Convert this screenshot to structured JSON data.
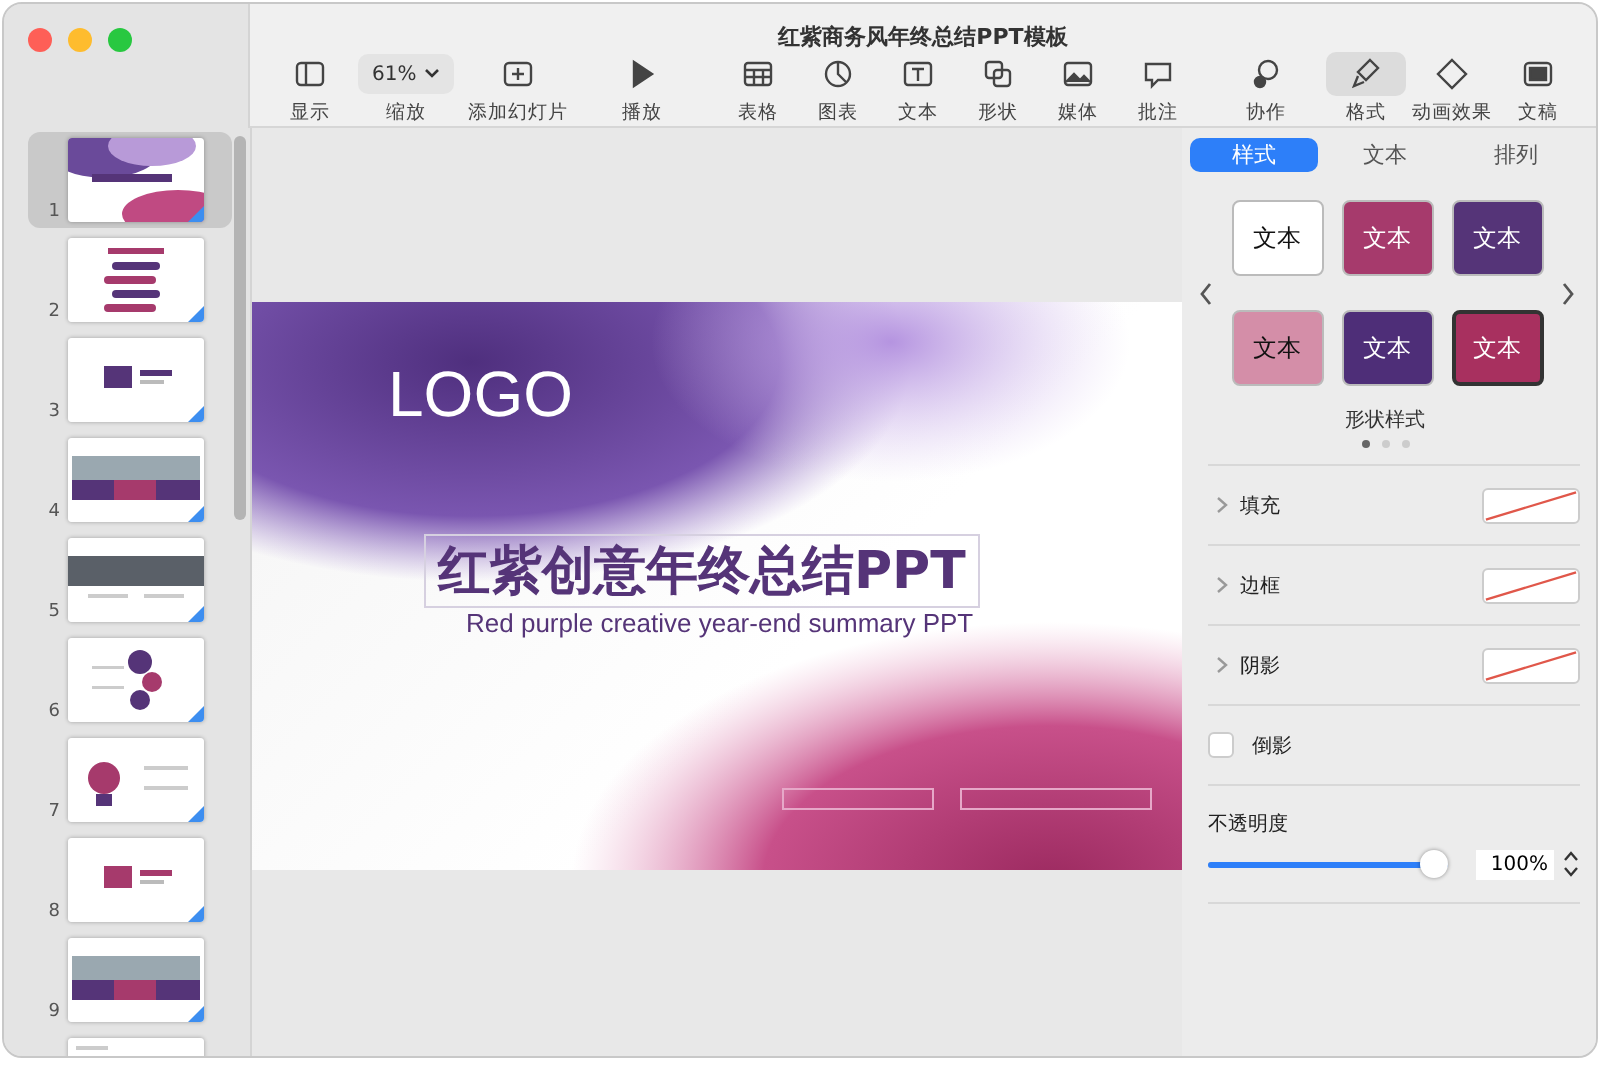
{
  "window": {
    "title": "红紫商务风年终总结PPT模板"
  },
  "toolbar": [
    {
      "kind": "sidebar",
      "label": "显示",
      "selected": false
    },
    {
      "kind": "zoom",
      "label": "缩放",
      "value": "61%",
      "selected": false
    },
    {
      "kind": "add",
      "label": "添加幻灯片",
      "selected": false
    },
    {
      "kind": "play",
      "label": "播放",
      "selected": false
    },
    {
      "kind": "table",
      "label": "表格",
      "selected": false
    },
    {
      "kind": "chart",
      "label": "图表",
      "selected": false
    },
    {
      "kind": "text",
      "label": "文本",
      "selected": false
    },
    {
      "kind": "shape",
      "label": "形状",
      "selected": false
    },
    {
      "kind": "media",
      "label": "媒体",
      "selected": false
    },
    {
      "kind": "comment",
      "label": "批注",
      "selected": false
    },
    {
      "kind": "collaborate",
      "label": "协作",
      "selected": false
    },
    {
      "kind": "format",
      "label": "格式",
      "selected": true
    },
    {
      "kind": "animate",
      "label": "动画效果",
      "selected": false
    },
    {
      "kind": "document",
      "label": "文稿",
      "selected": false
    }
  ],
  "slides": [
    {
      "number": "1",
      "kind": "cover",
      "selected": true
    },
    {
      "number": "2",
      "kind": "agenda",
      "selected": false
    },
    {
      "number": "3",
      "kind": "section",
      "selected": false
    },
    {
      "number": "4",
      "kind": "photo-grid",
      "selected": false
    },
    {
      "number": "5",
      "kind": "photo-strip",
      "selected": false
    },
    {
      "number": "6",
      "kind": "diagram",
      "selected": false
    },
    {
      "number": "7",
      "kind": "infographic",
      "selected": false
    },
    {
      "number": "8",
      "kind": "section",
      "selected": false
    },
    {
      "number": "9",
      "kind": "photo-grid",
      "selected": false
    },
    {
      "kind": "plain",
      "selected": false
    }
  ],
  "slide": {
    "logo": "LOGO",
    "title": "红紫创意年终总结PPT",
    "subtitle": "Red purple creative year-end summary PPT"
  },
  "inspector": {
    "tabs": [
      {
        "label": "样式",
        "selected": true
      },
      {
        "label": "文本",
        "selected": false
      },
      {
        "label": "排列",
        "selected": false
      }
    ],
    "swatches": [
      {
        "label": "文本",
        "color": "#ffffff",
        "selected": false
      },
      {
        "label": "文本",
        "color": "#a63a6c",
        "selected": false
      },
      {
        "label": "文本",
        "color": "#553478",
        "selected": false
      },
      {
        "label": "文本",
        "color": "#d48ea8",
        "selected": false
      },
      {
        "label": "文本",
        "color": "#4e2e78",
        "selected": false
      },
      {
        "label": "文本",
        "color": "#a8305f",
        "selected": true
      }
    ],
    "swatch_caption": "形状样式",
    "pages": [
      {
        "selected": true
      },
      {
        "selected": false
      },
      {
        "selected": false
      }
    ],
    "rows": [
      {
        "kind": "well",
        "label": "填充",
        "expanded": false
      },
      {
        "kind": "well",
        "label": "边框",
        "expanded": false
      },
      {
        "kind": "well",
        "label": "阴影",
        "expanded": false
      },
      {
        "kind": "checkbox",
        "label": "倒影",
        "checked": false
      }
    ],
    "opacity": {
      "label": "不透明度",
      "level": 1,
      "value": "100%"
    }
  }
}
